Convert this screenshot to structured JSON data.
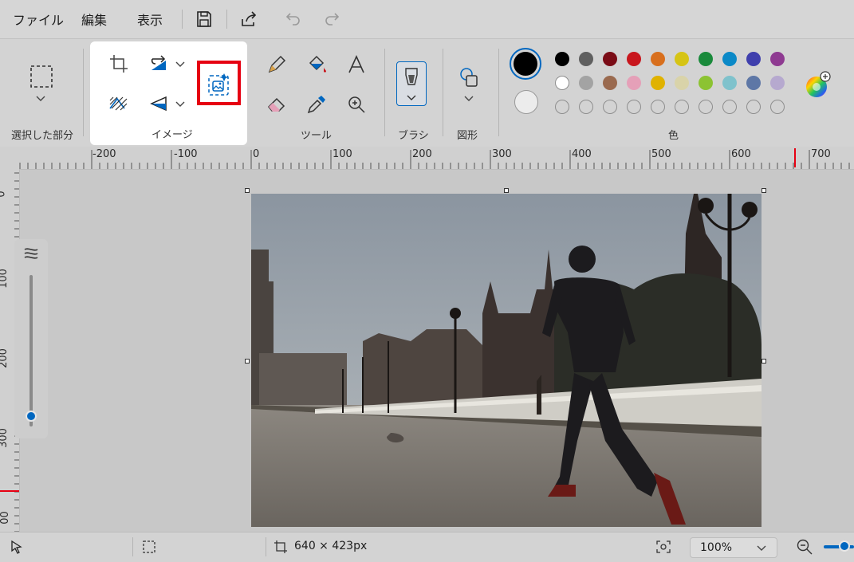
{
  "menu": {
    "file": "ファイル",
    "edit": "編集",
    "view": "表示"
  },
  "quick_access": [
    "save-icon",
    "share-icon",
    "undo-icon",
    "redo-icon"
  ],
  "ribbon": {
    "selection_label": "選択した部分",
    "image_label": "イメージ",
    "tools_label": "ツール",
    "brush_label": "ブラシ",
    "shapes_label": "図形",
    "colors_label": "色"
  },
  "colors": {
    "primary": "#000000",
    "secondary": "#ffffff",
    "palette_row1": [
      "#000000",
      "#5f5f5f",
      "#7a0c16",
      "#c8161d",
      "#d86f1d",
      "#d6c415",
      "#1a8a3b",
      "#0b89c7",
      "#3f3fad",
      "#8e3a91"
    ],
    "palette_row2": [
      "#ffffff",
      "#a3a3a3",
      "#9a6a4f",
      "#e5a0b8",
      "#e0b200",
      "#d9d3a9",
      "#8cc332",
      "#7fc2cc",
      "#5e77a6",
      "#b6a9cf"
    ],
    "accent": "#0067c0",
    "highlight": "#e60012"
  },
  "ruler": {
    "top": [
      "-200",
      "-100",
      "0",
      "100",
      "200",
      "300",
      "400",
      "500",
      "600",
      "700"
    ],
    "left": [
      "0",
      "100",
      "200",
      "300",
      "00"
    ]
  },
  "status": {
    "image_size": "640 × 423px",
    "zoom": "100%"
  }
}
